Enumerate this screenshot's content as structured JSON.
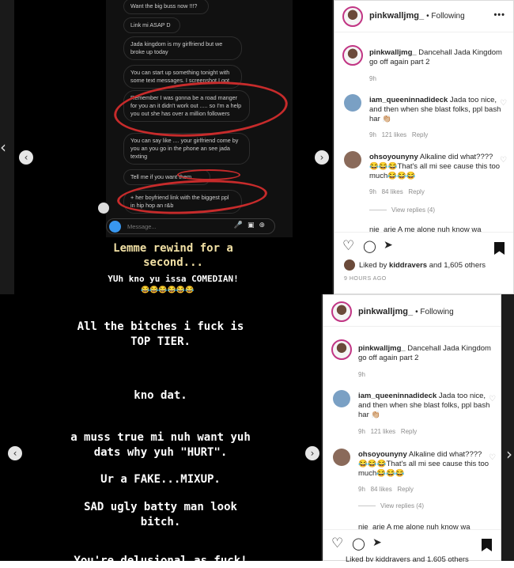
{
  "top_story": {
    "messages": [
      "Want the big buss now !!!?",
      "Link mi ASAP D",
      "Jada kingdom is my girlfriend but we broke up today",
      "You can start up something tonight with some text messages. I screenshot I got",
      "Remember I was gonna be a road manger for you an it didn't work out ..... so I'm a help you out she has over a million followers",
      "You can say like .... your girlfriend come by you an you go in the phone an see jada texting",
      "Tell me if you want them",
      "+ her boyfriend link with the biggest ppl in hip hop an r&b"
    ],
    "composer_placeholder": "Message...",
    "caption_line1": "Lemme rewind for a",
    "caption_line2": "second...",
    "caption_line3": "YUh kno yu issa COMEDIAN!",
    "emojis": "😂😂😂😂😂😂"
  },
  "post": {
    "username": "pinkwalljmg_",
    "following": "• Following",
    "more": "•••",
    "caption_user": "pinkwalljmg_",
    "caption_text": "Dancehall Jada Kingdom go off again part 2",
    "caption_age": "9h",
    "comments": [
      {
        "user": "iam_queeninnadideck",
        "text": "Jada too nice, and then when she blast folks, ppl bash har 👏🏼",
        "age": "9h",
        "likes": "121 likes",
        "reply": "Reply"
      },
      {
        "user": "ohsoyounyny",
        "text": "Alkaline did what????😂😂😂That's all mi see cause this too much😂😂😂",
        "age": "9h",
        "likes": "84 likes",
        "reply": "Reply"
      }
    ],
    "view_replies": "View replies (4)",
    "partial_comment": "nie_arie  A me alone nuh know wa",
    "liked_by_prefix": "Liked by ",
    "liked_by_user": "kiddravers",
    "liked_by_suffix": " and 1,605 others",
    "time_ago": "9 HOURS AGO"
  },
  "bottom_story": {
    "lines": [
      "All the bitches i fuck is",
      "TOP TIER.",
      "kno dat.",
      "a muss true mi nuh want yuh",
      "dats why yuh \"HURT\".",
      "Ur a FAKE...MIXUP.",
      "SAD ugly batty man look",
      "bitch.",
      "You're delusional as fuck!"
    ]
  },
  "post2": {
    "username": "pinkwalljmg_",
    "following": "• Following",
    "caption_user": "pinkwalljmg_",
    "caption_text": "Dancehall Jada Kingdom go off again part 2",
    "caption_age": "9h",
    "comments": [
      {
        "user": "iam_queeninnadideck",
        "text": "Jada too nice, and then when she blast folks, ppl bash har 👏🏼",
        "age": "9h",
        "likes": "121 likes",
        "reply": "Reply"
      },
      {
        "user": "ohsoyounyny",
        "text": "Alkaline did what????😂😂😂That's all mi see cause this too much😂😂😂",
        "age": "9h",
        "likes": "84 likes",
        "reply": "Reply"
      }
    ],
    "view_replies": "View replies (4)",
    "partial_comment": "nie_arie  A me alone nuh know wa",
    "liked_partial": "Liked by kiddravers and 1,605 others"
  },
  "icons": {
    "prev": "‹",
    "next": "›",
    "heart": "♡",
    "comment": "◯",
    "share": "➤"
  }
}
